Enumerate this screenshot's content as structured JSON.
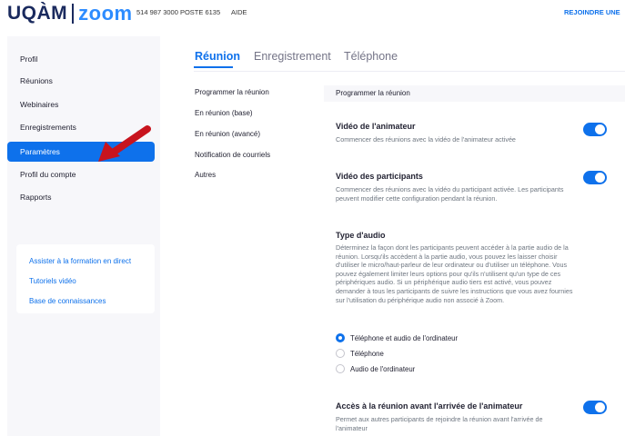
{
  "header": {
    "logo_left": "UQÀM",
    "logo_right": "zoom",
    "phone": "514 987 3000 POSTE 6135",
    "help": "AIDE",
    "join": "REJOINDRE UNE"
  },
  "sidebar": {
    "items": [
      {
        "label": "Profil",
        "active": false
      },
      {
        "label": "Réunions",
        "active": false
      },
      {
        "label": "Webinaires",
        "active": false
      },
      {
        "label": "Enregistrements",
        "active": false
      },
      {
        "label": "Paramètres",
        "active": true
      },
      {
        "label": "Profil du compte",
        "active": false
      },
      {
        "label": "Rapports",
        "active": false
      }
    ],
    "help_links": [
      "Assister à la formation en direct",
      "Tutoriels vidéo",
      "Base de connaissances"
    ]
  },
  "tabs": [
    {
      "label": "Réunion",
      "active": true
    },
    {
      "label": "Enregistrement",
      "active": false
    },
    {
      "label": "Téléphone",
      "active": false
    }
  ],
  "submenu": [
    "Programmer la réunion",
    "En réunion (base)",
    "En réunion (avancé)",
    "Notification de courriels",
    "Autres"
  ],
  "content": {
    "section_header": "Programmer la réunion",
    "settings": [
      {
        "title": "Vidéo de l'animateur",
        "desc": "Commencer des réunions avec la vidéo de l'animateur activée",
        "enabled": true
      },
      {
        "title": "Vidéo des participants",
        "desc": "Commencer des réunions avec la vidéo du participant activée. Les participants peuvent modifier cette configuration pendant la réunion.",
        "enabled": true
      },
      {
        "title": "Accès à la réunion avant l'arrivée de l'animateur",
        "desc": "Permet aux autres participants de rejoindre la réunion avant l'arrivée de l'animateur",
        "enabled": true
      }
    ],
    "audio": {
      "title": "Type d'audio",
      "desc": "Déterminez la façon dont les participants peuvent accéder à la partie audio de la réunion. Lorsqu'ils accèdent à la partie audio, vous pouvez les laisser choisir d'utiliser le micro/haut-parleur de leur ordinateur ou d'utiliser un téléphone. Vous pouvez également limiter leurs options pour qu'ils n'utilisent qu'un type de ces périphériques audio. Si un périphérique audio tiers est activé, vous pouvez demander à tous les participants de suivre les instructions que vous avez fournies sur l'utilisation du périphérique audio non associé à Zoom.",
      "options": [
        {
          "label": "Téléphone et audio de l'ordinateur",
          "selected": true
        },
        {
          "label": "Téléphone",
          "selected": false
        },
        {
          "label": "Audio de l'ordinateur",
          "selected": false
        }
      ]
    }
  },
  "colors": {
    "accent": "#0e71eb",
    "arrow": "#c8141e",
    "brand_dark": "#1a2a5e"
  }
}
